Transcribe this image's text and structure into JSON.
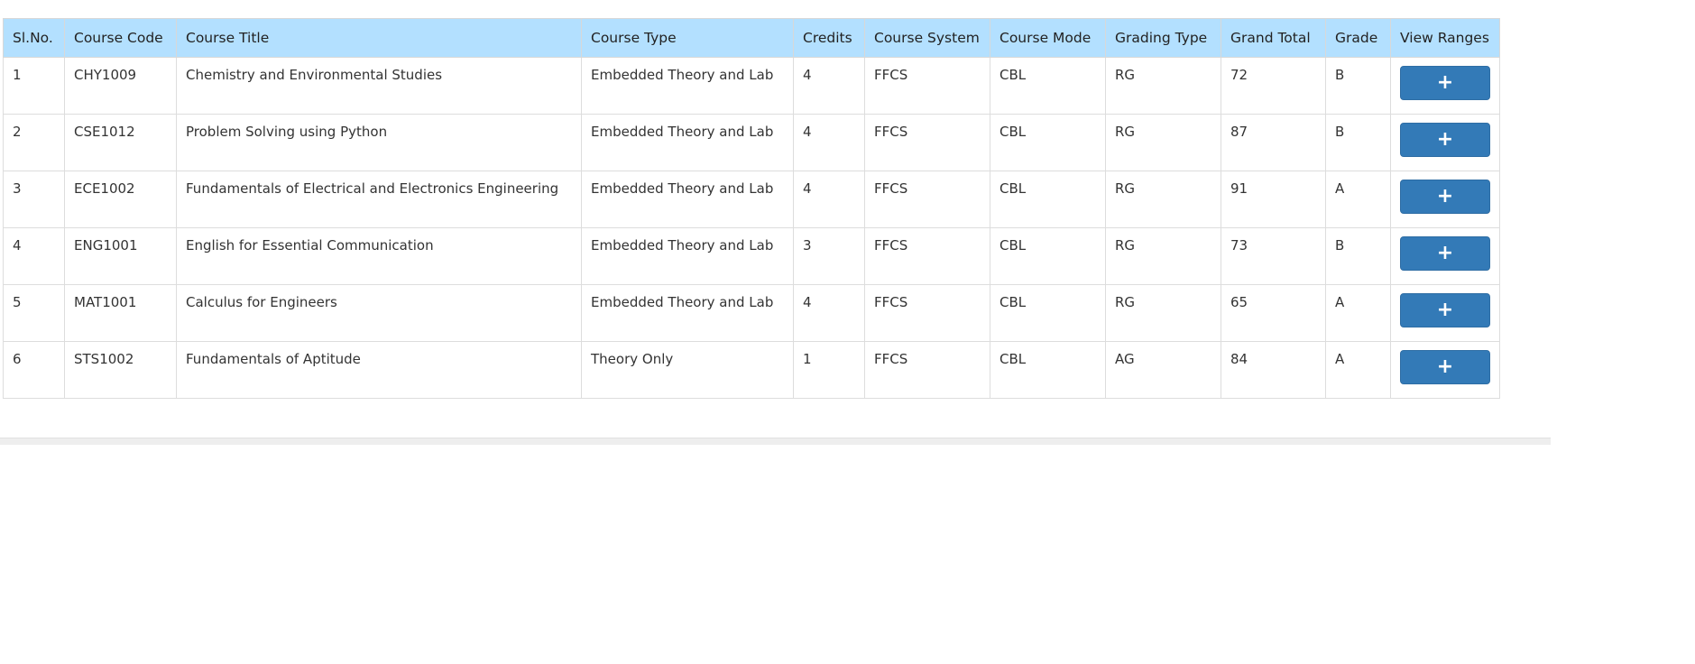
{
  "table": {
    "headers": [
      "Sl.No.",
      "Course Code",
      "Course Title",
      "Course Type",
      "Credits",
      "Course System",
      "Course Mode",
      "Grading Type",
      "Grand Total",
      "Grade",
      "View Ranges"
    ],
    "rows": [
      {
        "slno": "1",
        "code": "CHY1009",
        "title": "Chemistry and Environmental Studies",
        "type": "Embedded Theory and Lab",
        "credits": "4",
        "system": "FFCS",
        "mode": "CBL",
        "grading": "RG",
        "total": "72",
        "grade": "B"
      },
      {
        "slno": "2",
        "code": "CSE1012",
        "title": "Problem Solving using Python",
        "type": "Embedded Theory and Lab",
        "credits": "4",
        "system": "FFCS",
        "mode": "CBL",
        "grading": "RG",
        "total": "87",
        "grade": "B"
      },
      {
        "slno": "3",
        "code": "ECE1002",
        "title": "Fundamentals of Electrical and Electronics Engineering",
        "type": "Embedded Theory and Lab",
        "credits": "4",
        "system": "FFCS",
        "mode": "CBL",
        "grading": "RG",
        "total": "91",
        "grade": "A"
      },
      {
        "slno": "4",
        "code": "ENG1001",
        "title": "English for Essential Communication",
        "type": "Embedded Theory and Lab",
        "credits": "3",
        "system": "FFCS",
        "mode": "CBL",
        "grading": "RG",
        "total": "73",
        "grade": "B"
      },
      {
        "slno": "5",
        "code": "MAT1001",
        "title": "Calculus for Engineers",
        "type": "Embedded Theory and Lab",
        "credits": "4",
        "system": "FFCS",
        "mode": "CBL",
        "grading": "RG",
        "total": "65",
        "grade": "A"
      },
      {
        "slno": "6",
        "code": "STS1002",
        "title": "Fundamentals of Aptitude",
        "type": "Theory Only",
        "credits": "1",
        "system": "FFCS",
        "mode": "CBL",
        "grading": "AG",
        "total": "84",
        "grade": "A"
      }
    ],
    "view_button_icon": "plus-icon",
    "view_button_glyph": "+"
  },
  "colors": {
    "header_bg": "#b3e0ff",
    "button_bg": "#337ab7"
  }
}
